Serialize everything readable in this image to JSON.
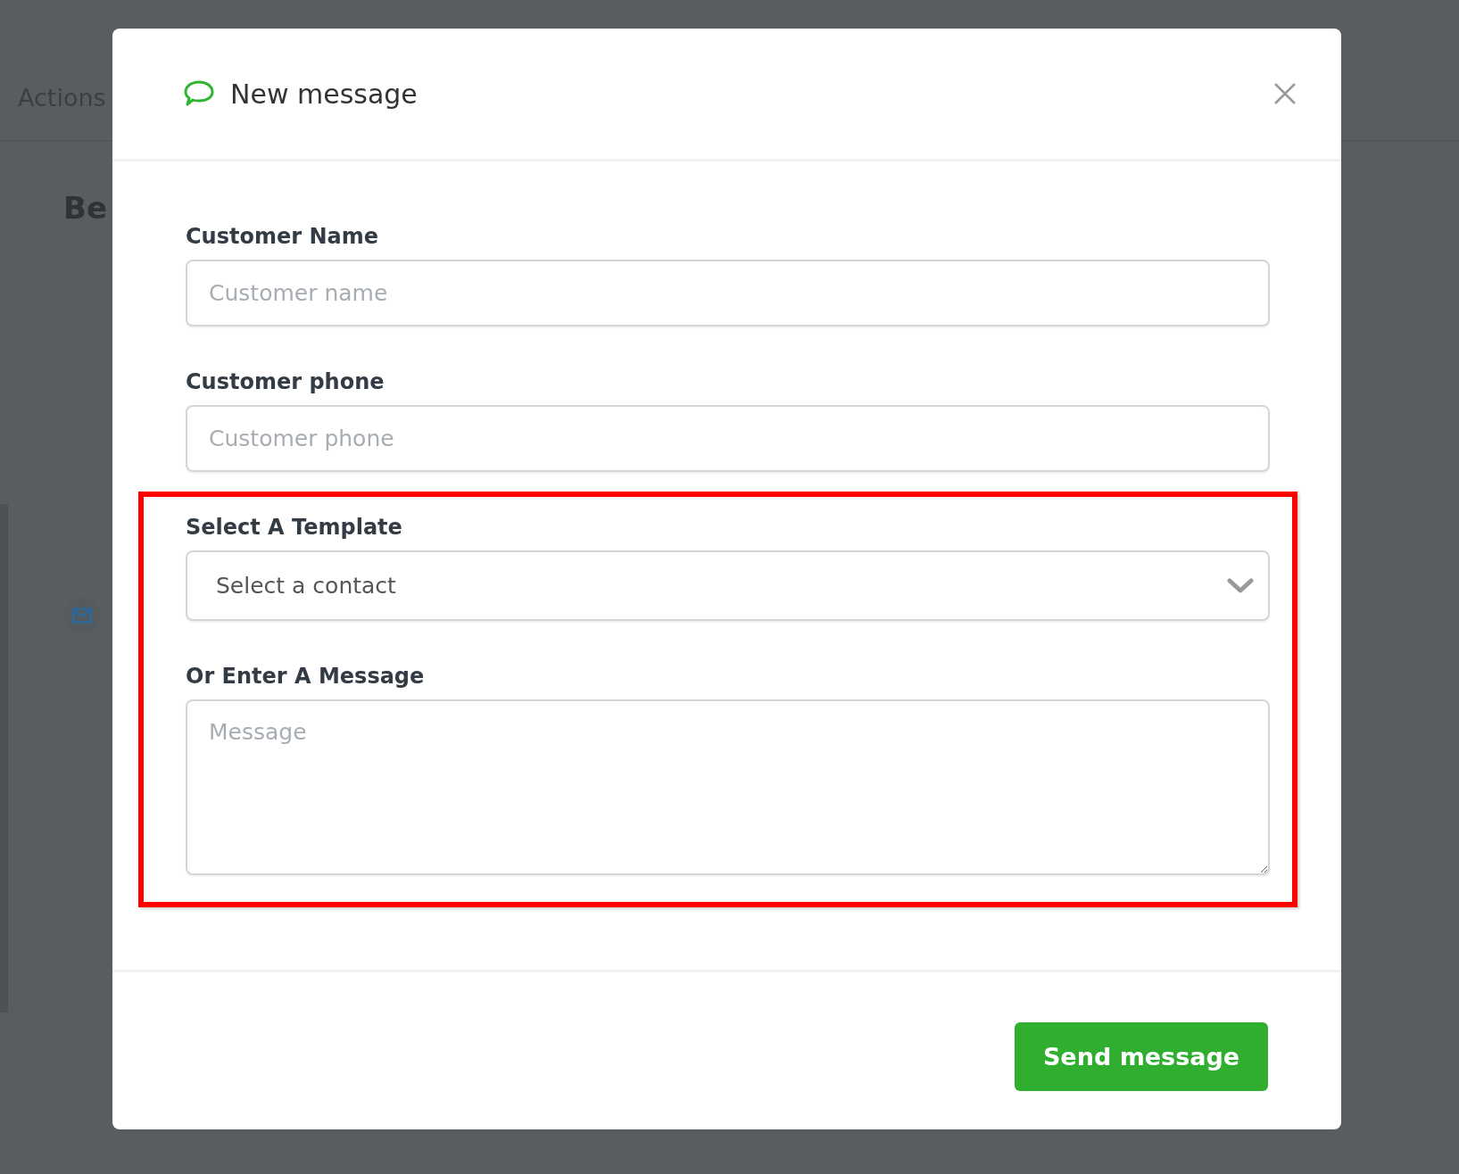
{
  "background": {
    "nav_text": "Actions",
    "heading": "Be"
  },
  "modal": {
    "title": "New message",
    "fields": [
      {
        "kind": "input",
        "label": "Customer Name",
        "placeholder": "Customer name"
      },
      {
        "kind": "input",
        "label": "Customer phone",
        "placeholder": "Customer phone"
      },
      {
        "kind": "select",
        "label": "Select A Template",
        "placeholder": "Select a contact"
      },
      {
        "kind": "textarea",
        "label": "Or Enter A Message",
        "placeholder": "Message"
      }
    ],
    "send_button": "Send message"
  }
}
